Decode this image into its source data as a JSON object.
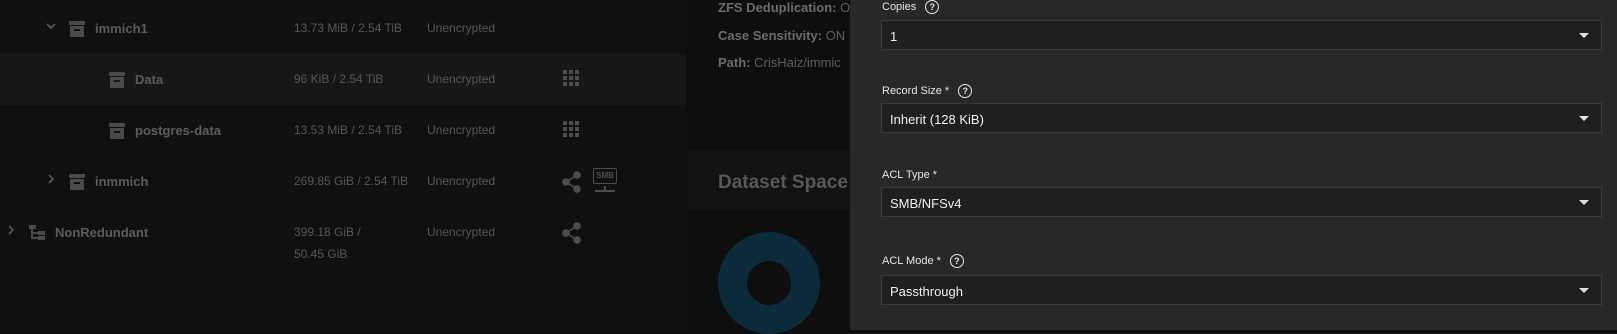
{
  "tree": {
    "rows": [
      {
        "name": "immich1",
        "used": "13.73 MiB / 2.54 TiB",
        "encryption": "Unencrypted"
      },
      {
        "name": "Data",
        "used": "96 KiB / 2.54 TiB",
        "encryption": "Unencrypted"
      },
      {
        "name": "postgres-data",
        "used": "13.53 MiB / 2.54 TiB",
        "encryption": "Unencrypted"
      },
      {
        "name": "inmmich",
        "used": "269.85 GiB / 2.54 TiB",
        "encryption": "Unencrypted",
        "badge": "SMB"
      },
      {
        "name": "NonRedundant",
        "used_line1": "399.18 GiB /",
        "used_line2": "50.45 GiB",
        "encryption": "Unencrypted"
      }
    ]
  },
  "details": {
    "dedup_label": "ZFS Deduplication:",
    "dedup_value": "O",
    "case_label": "Case Sensitivity:",
    "case_value": "ON",
    "path_label": "Path:",
    "path_value": "CrisHaiz/immic",
    "space_title": "Dataset Space"
  },
  "form": {
    "copies": {
      "label": "Copies",
      "value": "1"
    },
    "record_size": {
      "label": "Record Size",
      "required": "*",
      "value": "Inherit (128 KiB)"
    },
    "acl_type": {
      "label": "ACL Type",
      "required": "*",
      "value": "SMB/NFSv4"
    },
    "acl_mode": {
      "label": "ACL Mode",
      "required": "*",
      "value": "Passthrough"
    },
    "help_glyph": "?"
  },
  "colors": {
    "panel": "#282828",
    "backdrop": "#0d0d0d",
    "donut": "#0c2a3a"
  }
}
